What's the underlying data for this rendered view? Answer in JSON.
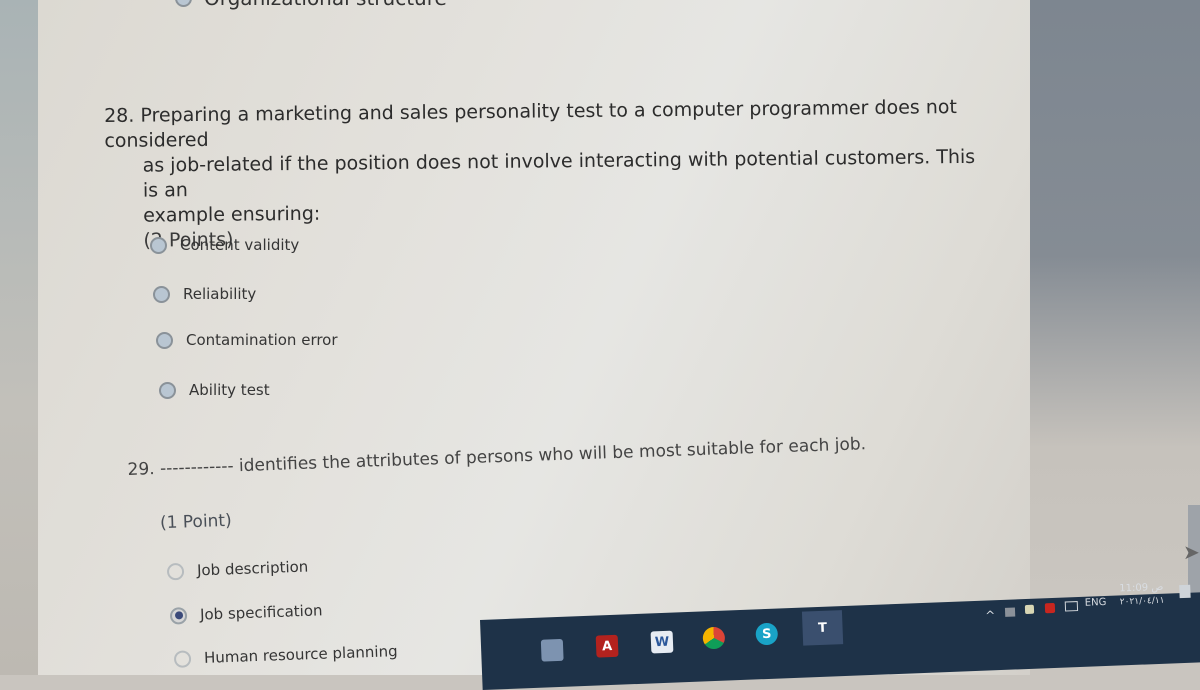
{
  "prev_option": {
    "label": "Organizational structure"
  },
  "questions": [
    {
      "number": "28.",
      "text_line1": "Preparing a marketing and sales personality test to a computer programmer does not considered",
      "text_line2": "as job-related if the position does not involve interacting with potential customers. This is an",
      "text_line3": "example ensuring:",
      "points": "(2 Points)",
      "options": [
        {
          "label": "Content validity",
          "selected": false
        },
        {
          "label": "Reliability",
          "selected": false
        },
        {
          "label": "Contamination error",
          "selected": false
        },
        {
          "label": "Ability test",
          "selected": false
        }
      ]
    },
    {
      "number": "29.",
      "blank": "------------",
      "text": "identifies the attributes of persons who will be most suitable for each job.",
      "points": "(1 Point)",
      "options": [
        {
          "label": "Job description",
          "selected": false
        },
        {
          "label": "Job specification",
          "selected": true
        },
        {
          "label": "Human resource planning",
          "selected": false
        }
      ]
    }
  ],
  "taskbar": {
    "apps": [
      {
        "name": "File Explorer",
        "glyph": ""
      },
      {
        "name": "Acrobat Reader",
        "glyph": "A"
      },
      {
        "name": "Word",
        "glyph": "W"
      },
      {
        "name": "Chrome",
        "glyph": ""
      },
      {
        "name": "Skype",
        "glyph": "S"
      },
      {
        "name": "Teams",
        "glyph": "T"
      }
    ],
    "tray": {
      "chevron": "^",
      "language": "ENG",
      "time": "11:09 ص",
      "date": "٢٠٢١/٠٤/١١"
    }
  }
}
